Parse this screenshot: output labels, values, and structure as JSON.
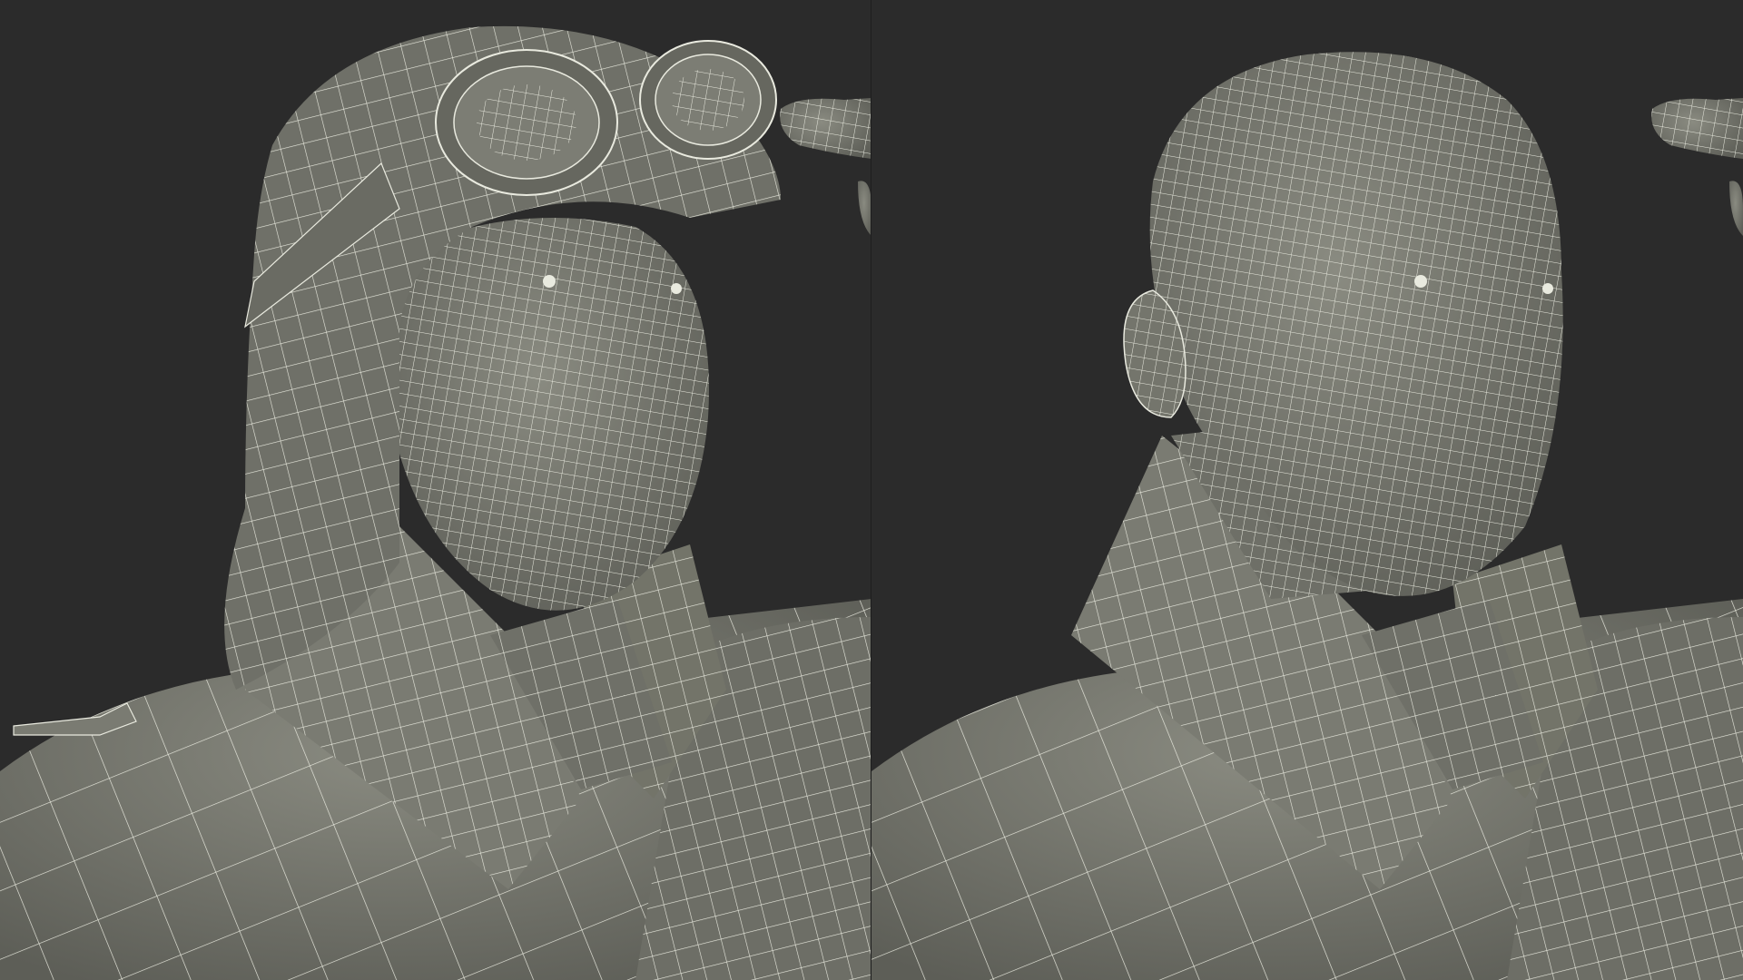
{
  "scene": {
    "background_color": "#2b2b2b",
    "mesh_fill_color": "#7a7b72",
    "mesh_shadow_color": "#55564f",
    "wire_color": "#e9eadf"
  },
  "panels": [
    {
      "subject": "aviator-with-leather-helmet-and-goggles",
      "variant": "helmet"
    },
    {
      "subject": "aviator-bald-head",
      "variant": "no-helmet"
    }
  ]
}
